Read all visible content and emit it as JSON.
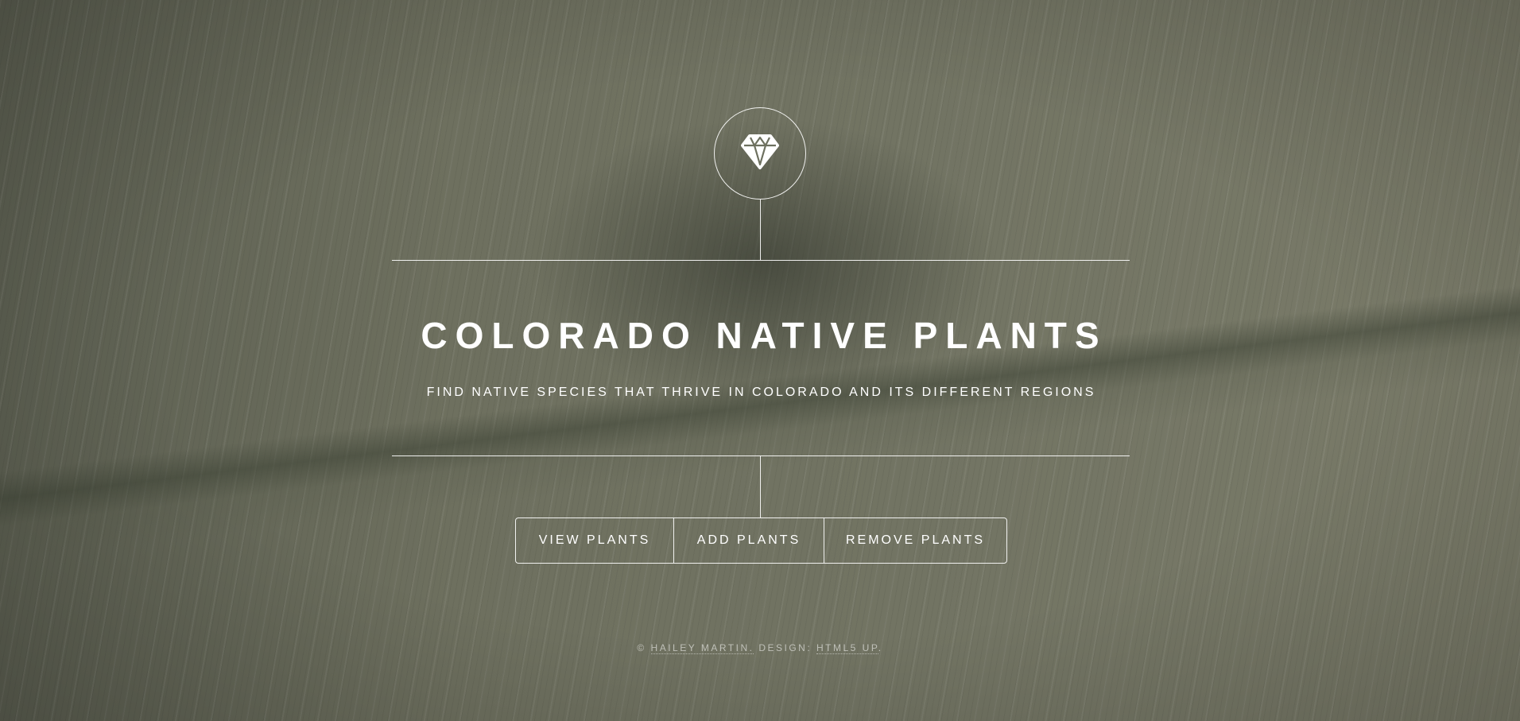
{
  "header": {
    "logo_icon": "diamond-icon",
    "title": "COLORADO NATIVE PLANTS",
    "subtitle": "FIND NATIVE SPECIES THAT THRIVE IN COLORADO AND ITS DIFFERENT REGIONS"
  },
  "nav": {
    "items": [
      {
        "label": "VIEW PLANTS"
      },
      {
        "label": "ADD PLANTS"
      },
      {
        "label": "REMOVE PLANTS"
      }
    ]
  },
  "footer": {
    "copyright_symbol": "©",
    "author_link": "HAILEY MARTIN.",
    "design_label": "DESIGN:",
    "design_link": "HTML5 UP",
    "end": "."
  },
  "colors": {
    "background": "#6d705f",
    "foreground": "#ffffff"
  }
}
